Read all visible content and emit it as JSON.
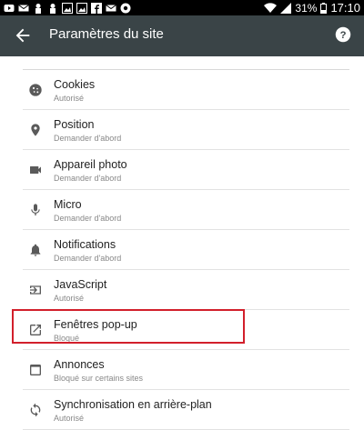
{
  "status_bar": {
    "battery": "31%",
    "time": "17:10",
    "icons": [
      "youtube-icon",
      "mail-icon",
      "person-icon",
      "person-icon",
      "image-icon",
      "image-icon",
      "facebook-icon",
      "mail-icon",
      "chrome-icon"
    ],
    "right_icons": [
      "wifi-icon",
      "signal-icon",
      "battery-icon"
    ]
  },
  "toolbar": {
    "title": "Paramètres du site",
    "back_icon": "arrow-back-icon",
    "help_icon": "help-icon"
  },
  "settings": [
    {
      "label": "Cookies",
      "status": "Autorisé",
      "icon": "cookie-icon"
    },
    {
      "label": "Position",
      "status": "Demander d'abord",
      "icon": "location-pin-icon"
    },
    {
      "label": "Appareil photo",
      "status": "Demander d'abord",
      "icon": "camera-icon"
    },
    {
      "label": "Micro",
      "status": "Demander d'abord",
      "icon": "microphone-icon"
    },
    {
      "label": "Notifications",
      "status": "Demander d'abord",
      "icon": "bell-icon"
    },
    {
      "label": "JavaScript",
      "status": "Autorisé",
      "icon": "javascript-icon"
    },
    {
      "label": "Fenêtres pop-up",
      "status": "Bloqué",
      "icon": "open-in-new-icon"
    },
    {
      "label": "Annonces",
      "status": "Bloqué sur certains sites",
      "icon": "ads-window-icon"
    },
    {
      "label": "Synchronisation en arrière-plan",
      "status": "Autorisé",
      "icon": "sync-icon"
    }
  ],
  "colors": {
    "toolbar": "#3a4447",
    "status_bar": "#000000",
    "highlight": "#d21f2b",
    "icon": "#5a5a5a"
  }
}
